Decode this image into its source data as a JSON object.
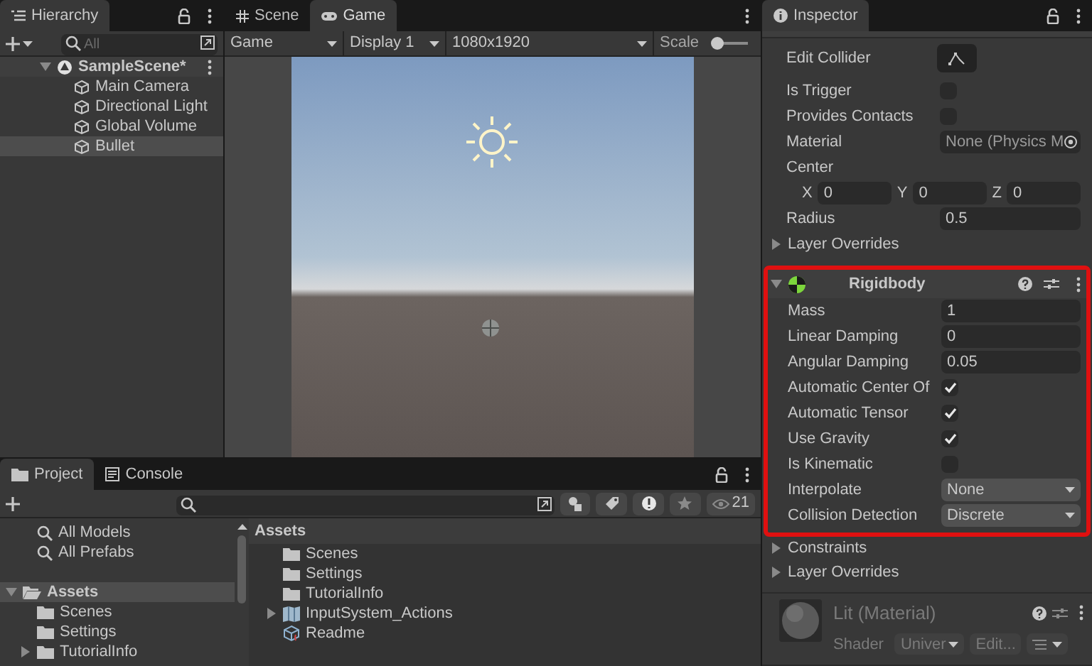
{
  "hierarchy": {
    "title": "Hierarchy",
    "search": {
      "placeholder": "All"
    },
    "scene": {
      "label": "SampleScene*",
      "expanded": true
    },
    "items": [
      {
        "label": "Main Camera",
        "selected": false
      },
      {
        "label": "Directional Light",
        "selected": false
      },
      {
        "label": "Global Volume",
        "selected": false
      },
      {
        "label": "Bullet",
        "selected": true
      }
    ]
  },
  "view_tabs": [
    {
      "label": "Scene",
      "selected": false
    },
    {
      "label": "Game",
      "selected": true
    }
  ],
  "game_toolbar": {
    "view": "Game",
    "display": "Display 1",
    "resolution": "1080x1920",
    "scale_label": "Scale"
  },
  "inspector": {
    "title": "Inspector",
    "collider_rows": [
      {
        "kind": "button",
        "label": "Edit Collider"
      },
      {
        "kind": "checkbox",
        "label": "Is Trigger",
        "checked": false
      },
      {
        "kind": "checkbox",
        "label": "Provides Contacts",
        "checked": false
      },
      {
        "kind": "object",
        "label": "Material",
        "value": "None (Physics M"
      },
      {
        "kind": "label",
        "label": "Center"
      },
      {
        "kind": "vector",
        "axes": [
          {
            "axis": "X",
            "value": "0"
          },
          {
            "axis": "Y",
            "value": "0"
          },
          {
            "axis": "Z",
            "value": "0"
          }
        ]
      },
      {
        "kind": "field",
        "label": "Radius",
        "value": "0.5"
      },
      {
        "kind": "foldout",
        "label": "Layer Overrides"
      }
    ],
    "rigidbody": {
      "name": "Rigidbody",
      "highlighted": true,
      "expanded": true,
      "rows": [
        {
          "kind": "field",
          "label": "Mass",
          "value": "1"
        },
        {
          "kind": "field",
          "label": "Linear Damping",
          "value": "0"
        },
        {
          "kind": "field",
          "label": "Angular Damping",
          "value": "0.05"
        },
        {
          "kind": "checkbox",
          "label": "Automatic Center Of",
          "checked": true
        },
        {
          "kind": "checkbox",
          "label": "Automatic Tensor",
          "checked": true
        },
        {
          "kind": "checkbox",
          "label": "Use Gravity",
          "checked": true
        },
        {
          "kind": "checkbox",
          "label": "Is Kinematic",
          "checked": false
        },
        {
          "kind": "dropdown",
          "label": "Interpolate",
          "value": "None"
        },
        {
          "kind": "dropdown",
          "label": "Collision Detection",
          "value": "Discrete"
        }
      ]
    },
    "after_rows": [
      {
        "kind": "foldout",
        "label": "Constraints"
      },
      {
        "kind": "foldout",
        "label": "Layer Overrides"
      }
    ],
    "material": {
      "name": "Lit (Material)",
      "shader_label": "Shader",
      "shader": "Univer",
      "edit_button": "Edit..."
    }
  },
  "project": {
    "tabs": [
      {
        "label": "Project",
        "selected": true
      },
      {
        "label": "Console",
        "selected": false
      }
    ],
    "hidden_count": "21",
    "favorites": [
      "All Models",
      "All Prefabs"
    ],
    "tree": [
      {
        "label": "Assets",
        "expanded": true,
        "selected": true,
        "children": [
          {
            "label": "Scenes",
            "expandable": false
          },
          {
            "label": "Settings",
            "expandable": false
          },
          {
            "label": "TutorialInfo",
            "expandable": true
          }
        ]
      }
    ],
    "breadcrumb": "Assets",
    "files": [
      {
        "kind": "folder",
        "label": "Scenes"
      },
      {
        "kind": "folder",
        "label": "Settings"
      },
      {
        "kind": "folder",
        "label": "TutorialInfo"
      },
      {
        "kind": "actions",
        "label": "InputSystem_Actions"
      },
      {
        "kind": "readme",
        "label": "Readme"
      }
    ]
  }
}
